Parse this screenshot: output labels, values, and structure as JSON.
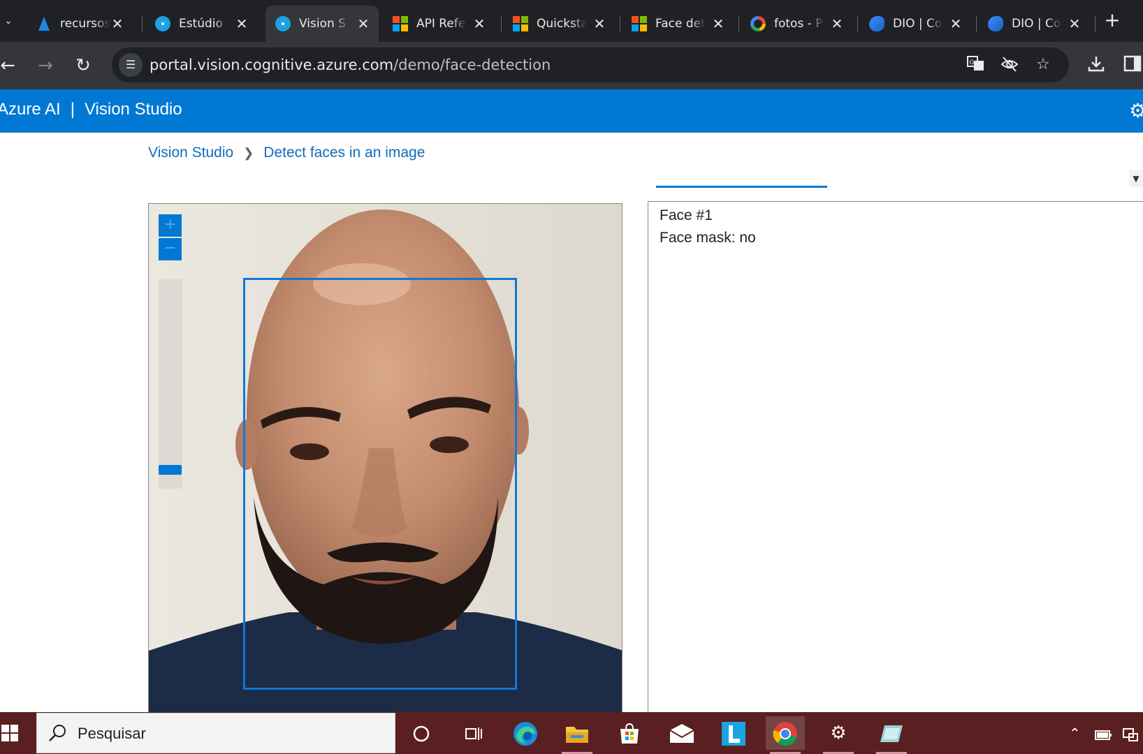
{
  "browser": {
    "tabs": [
      {
        "label": "recursos",
        "icon": "azure-icon",
        "active": false
      },
      {
        "label": "Estúdio",
        "icon": "vision-studio-icon",
        "active": false
      },
      {
        "label": "Vision S",
        "icon": "vision-studio-icon",
        "active": true
      },
      {
        "label": "API Refe",
        "icon": "microsoft-icon",
        "active": false
      },
      {
        "label": "Quicksta",
        "icon": "microsoft-icon",
        "active": false
      },
      {
        "label": "Face det",
        "icon": "microsoft-icon",
        "active": false
      },
      {
        "label": "fotos - P",
        "icon": "google-icon",
        "active": false
      },
      {
        "label": "DIO | Co",
        "icon": "dio-icon",
        "active": false
      },
      {
        "label": "DIO | Co",
        "icon": "dio-icon",
        "active": false
      }
    ],
    "close_glyph": "✕",
    "new_tab_glyph": "+",
    "url_host": "portal.vision.cognitive.azure.com",
    "url_path": "/demo/face-detection"
  },
  "app": {
    "brand": "Azure AI",
    "separator": "|",
    "product": "Vision Studio",
    "accent_color": "#0078d4"
  },
  "breadcrumb": {
    "root": "Vision Studio",
    "current": "Detect faces in an image"
  },
  "viewer": {
    "zoom_in": "+",
    "zoom_out": "−",
    "zoom_level": 0
  },
  "results": {
    "face_label": "Face #1",
    "face_mask": "Face mask: no"
  },
  "taskbar": {
    "search_placeholder": "Pesquisar",
    "apps": [
      "cortana-icon",
      "task-view-icon",
      "edge-icon",
      "file-explorer-icon",
      "microsoft-store-icon",
      "mail-icon",
      "l-app-icon",
      "chrome-icon",
      "settings-icon",
      "notes-icon"
    ],
    "accent_color": "#5a1f20"
  }
}
